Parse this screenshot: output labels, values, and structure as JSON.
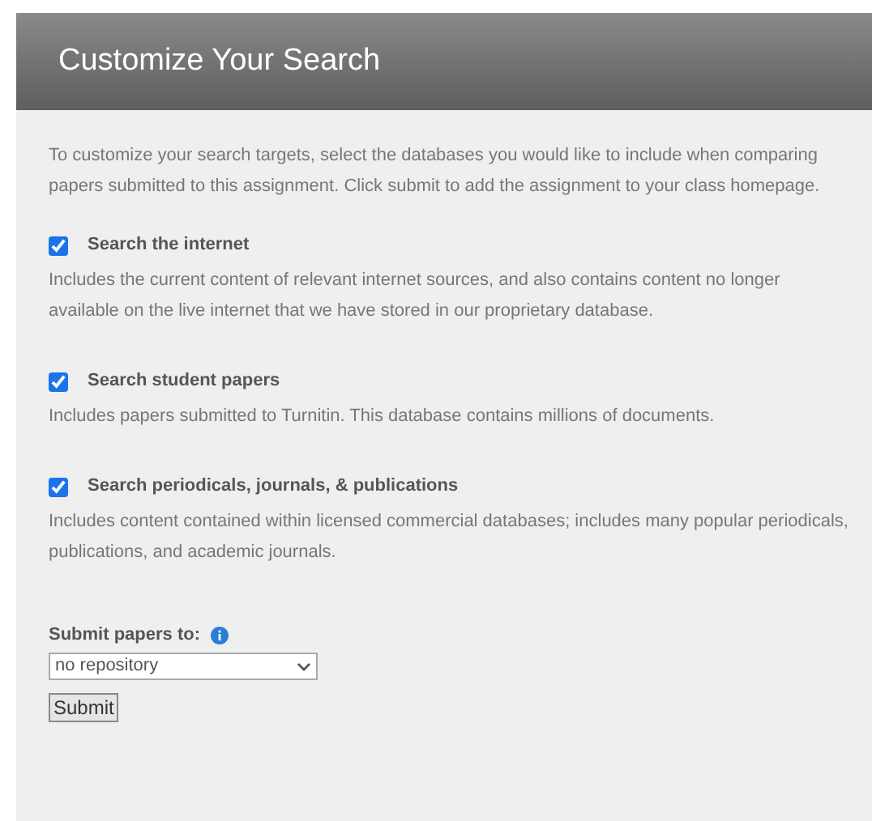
{
  "header": {
    "title": "Customize Your Search"
  },
  "intro": "To customize your search targets, select the databases you would like to include when comparing papers submitted to this assignment. Click submit to add the assignment to your class homepage.",
  "options": [
    {
      "label": "Search the internet",
      "checked": true,
      "description": "Includes the current content of relevant internet sources, and also contains content no longer available on the live internet that we have stored in our proprietary database."
    },
    {
      "label": "Search student papers",
      "checked": true,
      "description": "Includes papers submitted to Turnitin. This database contains millions of documents."
    },
    {
      "label": "Search periodicals, journals, & publications",
      "checked": true,
      "description": "Includes content contained within licensed commercial databases; includes many popular periodicals, publications, and academic journals."
    }
  ],
  "repository": {
    "label": "Submit papers to:",
    "value": "no repository"
  },
  "submit_button": "Submit"
}
